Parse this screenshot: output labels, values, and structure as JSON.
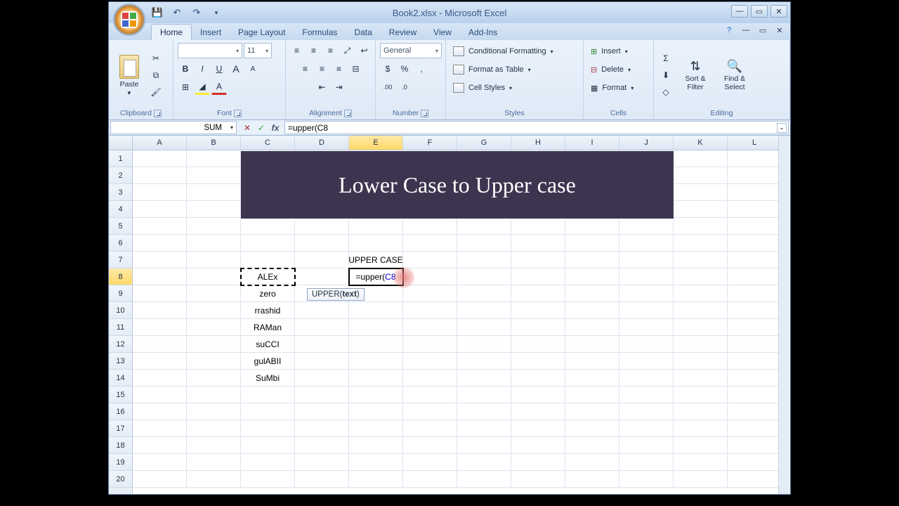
{
  "window": {
    "title_file": "Book2.xlsx",
    "title_app": "Microsoft Excel"
  },
  "qat": {
    "save": "💾",
    "undo": "↶",
    "redo": "↷",
    "more": "▾"
  },
  "tabs": {
    "items": [
      "Home",
      "Insert",
      "Page Layout",
      "Formulas",
      "Data",
      "Review",
      "View",
      "Add-Ins"
    ],
    "active": 0
  },
  "ribbon": {
    "clipboard": {
      "label": "Clipboard",
      "paste": "Paste",
      "cut": "✂",
      "copy": "⧉",
      "fmt": "🖌"
    },
    "font": {
      "label": "Font",
      "name": "",
      "size": "11",
      "bold": "B",
      "italic": "I",
      "underline": "U",
      "border": "⊞",
      "fill": "◢",
      "color": "A",
      "grow": "A",
      "shrink": "A"
    },
    "alignment": {
      "label": "Alignment"
    },
    "number": {
      "label": "Number",
      "format": "General",
      "currency": "$",
      "percent": "%",
      "comma": ",",
      "inc": "←0",
      "dec": "0→"
    },
    "styles": {
      "label": "Styles",
      "cond": "Conditional Formatting",
      "table": "Format as Table",
      "cell": "Cell Styles"
    },
    "cells": {
      "label": "Cells",
      "insert": "Insert",
      "delete": "Delete",
      "format": "Format"
    },
    "editing": {
      "label": "Editing",
      "sum": "Σ",
      "fill": "⬇",
      "clear": "◇",
      "sort": "Sort & Filter",
      "find": "Find & Select"
    }
  },
  "namebox": {
    "value": "SUM"
  },
  "formula_bar": {
    "prefix": "=upper(",
    "ref": "C8"
  },
  "columns": [
    "A",
    "B",
    "C",
    "D",
    "E",
    "F",
    "G",
    "H",
    "I",
    "J",
    "K",
    "L"
  ],
  "rows": [
    "1",
    "2",
    "3",
    "4",
    "5",
    "6",
    "7",
    "8",
    "9",
    "10",
    "11",
    "12",
    "13",
    "14",
    "15",
    "16",
    "17",
    "18",
    "19",
    "20"
  ],
  "active_col": 4,
  "active_row": 7,
  "sheet": {
    "banner_text": "Lower Case to Upper case",
    "e7": "UPPER CASE",
    "e8_prefix": "=upper(",
    "e8_ref": "C8",
    "c_values": [
      "ALEx",
      "zero",
      "rrashid",
      "RAMan",
      "suCCI",
      "gulABII",
      "SuMbi"
    ]
  },
  "tooltip": {
    "fn": "UPPER(",
    "arg": "text",
    "suffix": ")"
  }
}
